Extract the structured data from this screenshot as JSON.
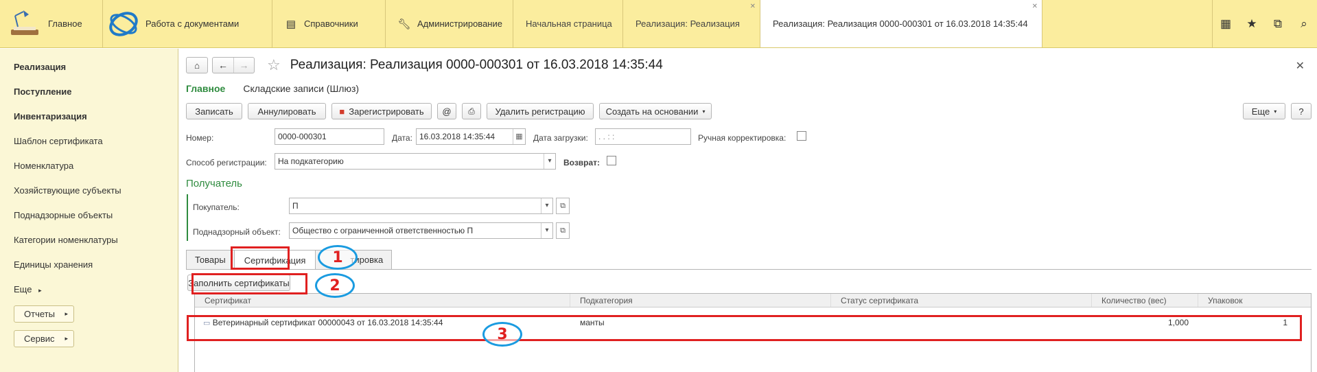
{
  "topbar": {
    "home_label": "Главное",
    "docs_label": "Работа с документами",
    "dict_label": "Справочники",
    "admin_label": "Администрирование",
    "tabs": [
      {
        "label": "Начальная страница"
      },
      {
        "label": "Реализация: Реализация"
      },
      {
        "label": "Реализация: Реализация 0000-000301 от 16.03.2018 14:35:44"
      }
    ]
  },
  "sidebar": {
    "items": [
      {
        "label": "Реализация",
        "bold": true
      },
      {
        "label": "Поступление",
        "bold": true
      },
      {
        "label": "Инвентаризация",
        "bold": true
      },
      {
        "label": "Шаблон сертификата"
      },
      {
        "label": "Номенклатура"
      },
      {
        "label": "Хозяйствующие субъекты"
      },
      {
        "label": "Поднадзорные объекты"
      },
      {
        "label": "Категории номенклатуры"
      },
      {
        "label": "Единицы хранения"
      },
      {
        "label": "Еще"
      }
    ],
    "reports_label": "Отчеты",
    "service_label": "Сервис"
  },
  "document": {
    "title": "Реализация: Реализация 0000-000301 от 16.03.2018 14:35:44",
    "subnav": [
      "Главное",
      "Складские записи (Шлюз)"
    ],
    "commands": {
      "write": "Записать",
      "cancel": "Аннулировать",
      "register": "Зарегистрировать",
      "delete_reg": "Удалить регистрацию",
      "create_based": "Создать на основании",
      "more": "Еще",
      "help": "?"
    },
    "fields": {
      "number_label": "Номер:",
      "number_value": "0000-000301",
      "date_label": "Дата:",
      "date_value": "16.03.2018 14:35:44",
      "load_date_label": "Дата загрузки:",
      "load_date_value": "  .  .       :  :",
      "manual_label": "Ручная корректировка:",
      "reg_method_label": "Способ регистрации:",
      "reg_method_value": "На подкатегорию",
      "return_label": "Возврат:"
    },
    "recipient": {
      "group_title": "Получатель",
      "buyer_label": "Покупатель:",
      "buyer_value": "П",
      "object_label": "Поднадзорный объект:",
      "object_value": "Общество с ограниченной ответственностью   П"
    },
    "tabs": [
      "Товары",
      "Сертификация",
      "тировка"
    ],
    "fill_button": "Заполнить сертификаты",
    "grid": {
      "columns": [
        "Сертификат",
        "Подкатегория",
        "Статус сертификата",
        "Количество (вес)",
        "Упаковок"
      ],
      "rows": [
        {
          "cert": "Ветеринарный сертификат 00000043 от 16.03.2018 14:35:44",
          "subcat": "манты",
          "status": "",
          "qty": "1,000",
          "packs": "1"
        }
      ]
    }
  },
  "annotations": [
    "1",
    "2",
    "3"
  ],
  "colors": {
    "accent_green": "#2e8b3e",
    "marker_red": "#e02020",
    "marker_blue": "#1a9be0",
    "topbar": "#fbed9e"
  }
}
